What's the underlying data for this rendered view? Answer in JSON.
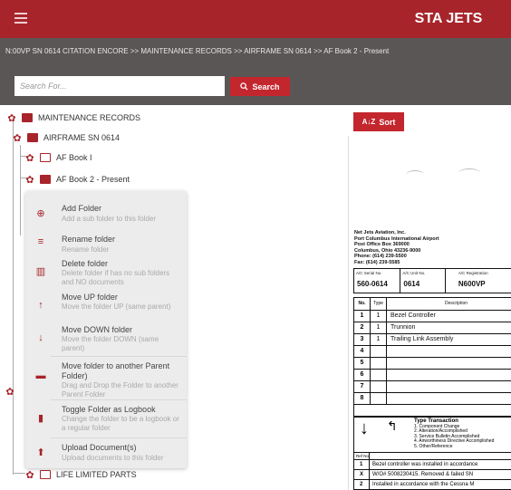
{
  "header": {
    "title": "STA JETS",
    "menu_icon": "hamburger-icon"
  },
  "breadcrumb": "N:00VP SN 0614 CITATION ENCORE >> MAINTENANCE RECORDS >> AIRFRAME SN 0614 >> AF Book 2 - Present",
  "search": {
    "placeholder": "Search For...",
    "button_label": "Search"
  },
  "tree": {
    "root": "MAINTENANCE RECORDS",
    "airframe": "AIRFRAME SN 0614",
    "book1": "AF Book I",
    "book2": "AF Book 2 - Present",
    "life_limited": "LIFE LIMITED PARTS"
  },
  "context_menu": [
    {
      "icon": "plus-circle-icon",
      "title": "Add Folder",
      "desc": "Add a sub folder to this folder"
    },
    {
      "icon": "rename-icon",
      "title": "Rename folder",
      "desc": "Rename folder"
    },
    {
      "icon": "trash-icon",
      "title": "Delete folder",
      "desc": "Delete folder if has no sub folders and NO documents"
    },
    {
      "icon": "arrow-up-icon",
      "title": "Move UP folder",
      "desc": "Move the folder UP (same parent)"
    },
    {
      "icon": "arrow-down-icon",
      "title": "Move DOWN folder",
      "desc": "Move the folder DOWN (same parent)"
    },
    {
      "icon": "folder-move-icon",
      "title": "Move folder to another Parent Folder)",
      "desc": "Drag and Drop the Folder to another Parent Folder"
    },
    {
      "icon": "book-icon",
      "title": "Toggle Folder as Logbook",
      "desc": "Change the folder to be a logbook or a regular folder"
    },
    {
      "icon": "upload-icon",
      "title": "Upload Document(s)",
      "desc": "Upload documents to this folder"
    }
  ],
  "sort": {
    "label": "Sort",
    "icon": "sort-az-icon"
  },
  "document": {
    "address": [
      "Net Jets Aviation, Inc.",
      "Port Columbus International Airport",
      "Post Office Box 369000",
      "Columbus, Ohio 43236-9000",
      "Phone: (614) 239-5500",
      "Fax: (614) 239-5585"
    ],
    "head": [
      {
        "label": "A/C Serial No.",
        "value": "560-0614"
      },
      {
        "label": "A/C Unit No.",
        "value": "0614"
      },
      {
        "label": "A/C Registration",
        "value": "N600VP"
      }
    ],
    "table_header": {
      "no": "No.",
      "type": "Type",
      "desc": "Description"
    },
    "rows": [
      {
        "no": "1",
        "type": "1",
        "desc": "Bezel Controller"
      },
      {
        "no": "2",
        "type": "1",
        "desc": "Trunnion"
      },
      {
        "no": "3",
        "type": "1",
        "desc": "Trailing Link Assembly"
      },
      {
        "no": "4",
        "type": "",
        "desc": ""
      },
      {
        "no": "5",
        "type": "",
        "desc": ""
      },
      {
        "no": "6",
        "type": "",
        "desc": ""
      },
      {
        "no": "7",
        "type": "",
        "desc": ""
      },
      {
        "no": "8",
        "type": "",
        "desc": ""
      }
    ],
    "type_transaction": [
      "Type Transaction",
      "1. Component Change",
      "2. Alteration/Accomplished",
      "3. Service Bulletin Accomplished",
      "4. Airworthiness Directive Accomplished",
      "5. Other/Reference"
    ],
    "ref_rows": [
      {
        "no": "Ref No.",
        "desc": ""
      },
      {
        "no": "1",
        "desc": "Bezel controller was installed in accordance"
      },
      {
        "no": "X",
        "desc": "W/O# 5008230415. Removed & failed SN"
      },
      {
        "no": "2",
        "desc": "Installed in accordance with the Cessna M"
      }
    ]
  }
}
